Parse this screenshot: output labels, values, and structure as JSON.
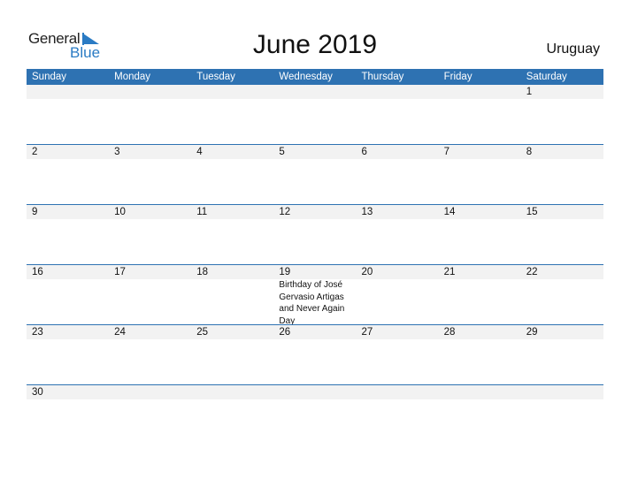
{
  "logo": {
    "word1": "General",
    "word2": "Blue"
  },
  "title": "June 2019",
  "country": "Uruguay",
  "colors": {
    "header_bg": "#2e72b2",
    "date_strip": "#f2f2f2",
    "logo_blue": "#2a7bc4"
  },
  "weekdays": [
    "Sunday",
    "Monday",
    "Tuesday",
    "Wednesday",
    "Thursday",
    "Friday",
    "Saturday"
  ],
  "weeks": [
    {
      "days": [
        "",
        "",
        "",
        "",
        "",
        "",
        "1"
      ]
    },
    {
      "days": [
        "2",
        "3",
        "4",
        "5",
        "6",
        "7",
        "8"
      ]
    },
    {
      "days": [
        "9",
        "10",
        "11",
        "12",
        "13",
        "14",
        "15"
      ]
    },
    {
      "days": [
        "16",
        "17",
        "18",
        "19",
        "20",
        "21",
        "22"
      ]
    },
    {
      "days": [
        "23",
        "24",
        "25",
        "26",
        "27",
        "28",
        "29"
      ]
    },
    {
      "days": [
        "30",
        "",
        "",
        "",
        "",
        "",
        ""
      ]
    }
  ],
  "events": [
    {
      "week": 3,
      "day": 3,
      "text": "Birthday of José Gervasio Artigas and Never Again Day"
    }
  ]
}
